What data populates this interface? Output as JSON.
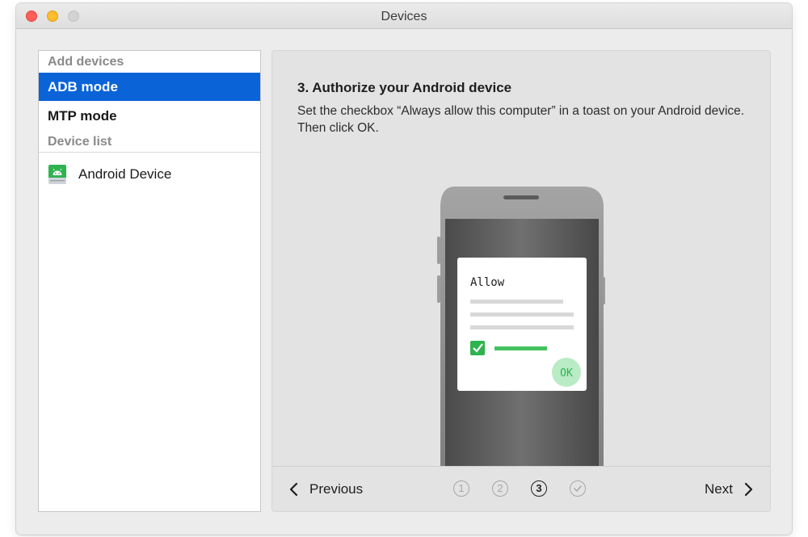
{
  "window": {
    "title": "Devices"
  },
  "sidebar": {
    "add_devices_header": "Add devices",
    "modes": [
      {
        "label": "ADB mode",
        "selected": true
      },
      {
        "label": "MTP mode",
        "selected": false
      }
    ],
    "device_list_header": "Device list",
    "devices": [
      {
        "label": "Android Device",
        "icon": "android-device-icon"
      }
    ]
  },
  "content": {
    "step_title": "3. Authorize your Android device",
    "step_description": "Set the checkbox “Always allow this computer” in a toast on your Android device. Then click OK.",
    "illustration": {
      "dialog_title": "Allow",
      "ok_label": "OK"
    }
  },
  "footer": {
    "previous_label": "Previous",
    "next_label": "Next",
    "steps": [
      {
        "label": "1",
        "state": "inactive"
      },
      {
        "label": "2",
        "state": "inactive"
      },
      {
        "label": "3",
        "state": "current"
      },
      {
        "label": "",
        "state": "done",
        "icon": "checkmark-icon"
      }
    ]
  },
  "colors": {
    "selection": "#0a64d8",
    "android_green": "#2fb350",
    "ok_button": "#b9ebc4"
  }
}
